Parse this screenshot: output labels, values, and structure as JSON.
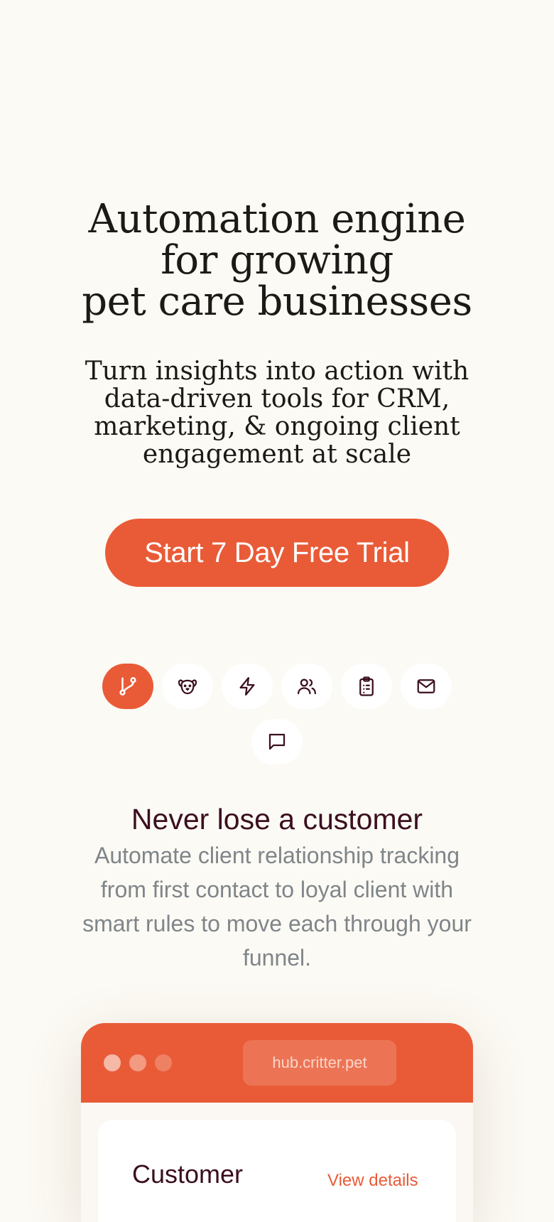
{
  "hero": {
    "title_lines": [
      "Automation engine",
      "for growing",
      "pet care businesses"
    ],
    "subtitle": "Turn insights into action with data-driven tools for CRM, marketing, & ongoing client engagement at scale",
    "cta_label": "Start 7 Day Free Trial"
  },
  "features": {
    "icons": [
      {
        "name": "branch-icon",
        "active": true
      },
      {
        "name": "dog-face-icon",
        "active": false
      },
      {
        "name": "lightning-icon",
        "active": false
      },
      {
        "name": "users-icon",
        "active": false
      },
      {
        "name": "clipboard-list-icon",
        "active": false
      },
      {
        "name": "mail-icon",
        "active": false
      },
      {
        "name": "chat-bubble-icon",
        "active": false
      }
    ],
    "active_title": "Never lose a customer",
    "active_description": "Automate client relationship tracking from first contact to loyal client with smart rules to move each through your funnel."
  },
  "browser": {
    "url": "hub.critter.pet",
    "panel_heading": "Customer",
    "panel_link": "View details"
  },
  "colors": {
    "background": "#fcfaf4",
    "accent": "#e95b37",
    "heading": "#3b0f20",
    "muted_text": "#7f858a"
  }
}
